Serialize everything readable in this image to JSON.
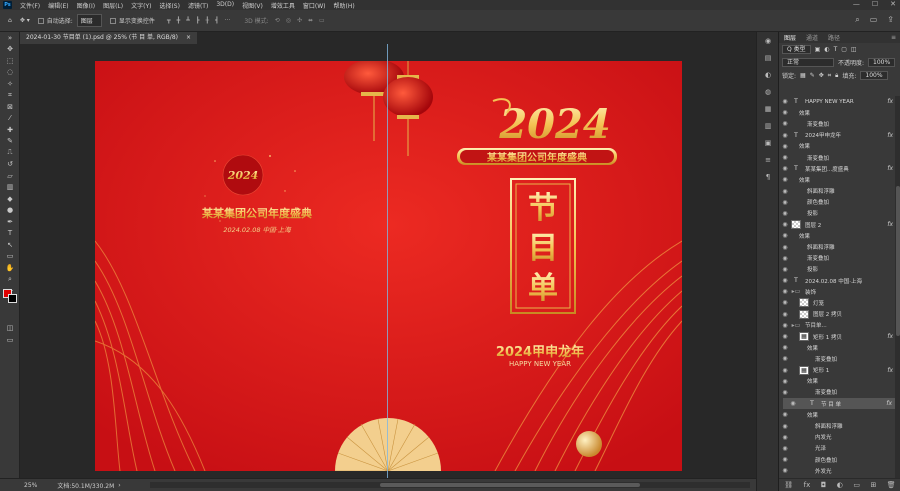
{
  "menu": {
    "items": [
      "文件(F)",
      "编辑(E)",
      "图像(I)",
      "图层(L)",
      "文字(Y)",
      "选择(S)",
      "滤镜(T)",
      "3D(D)",
      "视图(V)",
      "增效工具",
      "窗口(W)",
      "帮助(H)"
    ]
  },
  "options": {
    "auto_select_label": "自动选择:",
    "auto_select_value": "图层",
    "show_transform_label": "显示变换控件",
    "mode_3d": "3D 模式:"
  },
  "document": {
    "tab_title": "2024-01-30 节目单 (1).psd @ 25% (节 目 单, RGB/8)",
    "close": "×"
  },
  "status": {
    "zoom": "25%",
    "doc_size": "文档:50.1M/330.2M"
  },
  "artwork": {
    "badge_year": "2024",
    "left_title": "某某集团公司年度盛典",
    "left_date": "2024.02.08  中国·上海",
    "right_year": "2024",
    "right_banner": "某某集团公司年度盛典",
    "program_title": [
      "节",
      "目",
      "单"
    ],
    "dragon_year": "2024甲申龙年",
    "greeting": "HAPPY NEW YEAR"
  },
  "panel": {
    "tabs": [
      "图层",
      "通道",
      "路径"
    ],
    "filter_kind": "Q 类型",
    "blend_mode": "正常",
    "opacity_label": "不透明度:",
    "opacity_value": "100%",
    "lock_label": "锁定:",
    "fill_label": "填充:",
    "fill_value": "100%"
  },
  "layers": [
    {
      "kind": "text",
      "name": "HAPPY NEW YEAR",
      "fx": true,
      "indent": 0
    },
    {
      "kind": "sub",
      "name": "效果",
      "indent": 1
    },
    {
      "kind": "sub",
      "name": "渐变叠加",
      "indent": 2
    },
    {
      "kind": "text",
      "name": "2024甲申龙年",
      "fx": true,
      "indent": 0
    },
    {
      "kind": "sub",
      "name": "效果",
      "indent": 1
    },
    {
      "kind": "sub",
      "name": "渐变叠加",
      "indent": 2
    },
    {
      "kind": "text",
      "name": "某某集团...度盛典",
      "fx": true,
      "indent": 0
    },
    {
      "kind": "sub",
      "name": "效果",
      "indent": 1
    },
    {
      "kind": "sub",
      "name": "斜面和浮雕",
      "indent": 2
    },
    {
      "kind": "sub",
      "name": "颜色叠加",
      "indent": 2
    },
    {
      "kind": "sub",
      "name": "投影",
      "indent": 2
    },
    {
      "kind": "checker",
      "name": "图层 2",
      "fx": true,
      "indent": 0
    },
    {
      "kind": "sub",
      "name": "效果",
      "indent": 1
    },
    {
      "kind": "sub",
      "name": "斜面和浮雕",
      "indent": 2
    },
    {
      "kind": "sub",
      "name": "渐变叠加",
      "indent": 2
    },
    {
      "kind": "sub",
      "name": "投影",
      "indent": 2
    },
    {
      "kind": "text",
      "name": "2024.02.08  中国·上海",
      "indent": 0
    },
    {
      "kind": "folder",
      "name": "装饰",
      "indent": 0
    },
    {
      "kind": "checker",
      "name": "灯笼",
      "indent": 1
    },
    {
      "kind": "checker",
      "name": "图层 2 拷贝",
      "indent": 1
    },
    {
      "kind": "folder",
      "name": "节目单...",
      "indent": 0
    },
    {
      "kind": "shape",
      "name": "矩形 1 拷贝",
      "fx": true,
      "indent": 1
    },
    {
      "kind": "sub",
      "name": "效果",
      "indent": 2
    },
    {
      "kind": "sub",
      "name": "渐变叠加",
      "indent": 3
    },
    {
      "kind": "shape",
      "name": "矩形 1",
      "fx": true,
      "indent": 1
    },
    {
      "kind": "sub",
      "name": "效果",
      "indent": 2
    },
    {
      "kind": "sub",
      "name": "渐变叠加",
      "indent": 3
    },
    {
      "kind": "text",
      "name": "节 目 单",
      "fx": true,
      "indent": 1,
      "selected": true
    },
    {
      "kind": "sub",
      "name": "效果",
      "indent": 2
    },
    {
      "kind": "sub",
      "name": "斜面和浮雕",
      "indent": 3
    },
    {
      "kind": "sub",
      "name": "内发光",
      "indent": 3
    },
    {
      "kind": "sub",
      "name": "光泽",
      "indent": 3
    },
    {
      "kind": "sub",
      "name": "颜色叠加",
      "indent": 3
    },
    {
      "kind": "sub",
      "name": "外发光",
      "indent": 3
    },
    {
      "kind": "sub",
      "name": "投影",
      "indent": 3
    }
  ],
  "colors": {
    "bg": "#d81416",
    "gold": "#f7d27a",
    "foreground": "#e00000",
    "background": "#000000"
  }
}
